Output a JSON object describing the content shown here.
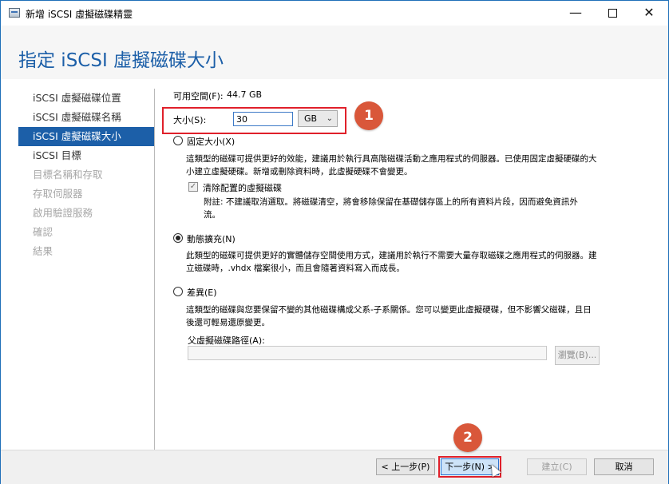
{
  "window": {
    "title": "新增 iSCSI 虛擬磁碟精靈",
    "controls": {
      "minimize": "—",
      "close": "✕"
    }
  },
  "header": {
    "title": "指定 iSCSI 虛擬磁碟大小"
  },
  "sidebar": {
    "items": [
      {
        "label": "iSCSI 虛擬磁碟位置",
        "state": "normal"
      },
      {
        "label": "iSCSI 虛擬磁碟名稱",
        "state": "normal"
      },
      {
        "label": "iSCSI 虛擬磁碟大小",
        "state": "selected"
      },
      {
        "label": "iSCSI 目標",
        "state": "normal"
      },
      {
        "label": "目標名稱和存取",
        "state": "disabled"
      },
      {
        "label": "存取伺服器",
        "state": "disabled"
      },
      {
        "label": "啟用驗證服務",
        "state": "disabled"
      },
      {
        "label": "確認",
        "state": "disabled"
      },
      {
        "label": "結果",
        "state": "disabled"
      }
    ]
  },
  "content": {
    "free_space_label": "可用空間(F):",
    "free_space_value": "44.7 GB",
    "size_label": "大小(S):",
    "size_value": "30",
    "unit": "GB",
    "fixed": {
      "label": "固定大小(X)",
      "desc": "這類型的磁碟可提供更好的效能，建議用於執行具高階磁碟活動之應用程式的伺服器。已使用固定虛擬硬碟的大小建立虛擬硬碟。新增或刪除資料時，此虛擬硬碟不會變更。",
      "clear_label": "清除配置的虛擬磁碟",
      "note": "附註: 不建議取消選取。將磁碟清空，將會移除保留在基礎儲存區上的所有資料片段，因而避免資訊外流。"
    },
    "dynamic": {
      "label": "動態擴充(N)",
      "desc": "此類型的磁碟可提供更好的實體儲存空間使用方式，建議用於執行不需要大量存取磁碟之應用程式的伺服器。建立磁碟時，.vhdx 檔案很小，而且會隨著資料寫入而成長。"
    },
    "differencing": {
      "label": "差異(E)",
      "desc": "這類型的磁碟與您要保留不變的其他磁碟構成父系-子系關係。您可以變更此虛擬硬碟，但不影響父磁碟，且日後還可輕易還原變更。",
      "parent_path_label": "父虛擬磁碟路徑(A):",
      "parent_path_value": "",
      "browse_label": "瀏覽(B)..."
    },
    "selected_option": "dynamic"
  },
  "footer": {
    "back": "< 上一步(P)",
    "next": "下一步(N) >",
    "create": "建立(C)",
    "cancel": "取消"
  },
  "callouts": {
    "one": "1",
    "two": "2"
  },
  "colors": {
    "accent": "#1c5fa8",
    "callout_border": "#e0202a",
    "badge": "#d9573a"
  }
}
